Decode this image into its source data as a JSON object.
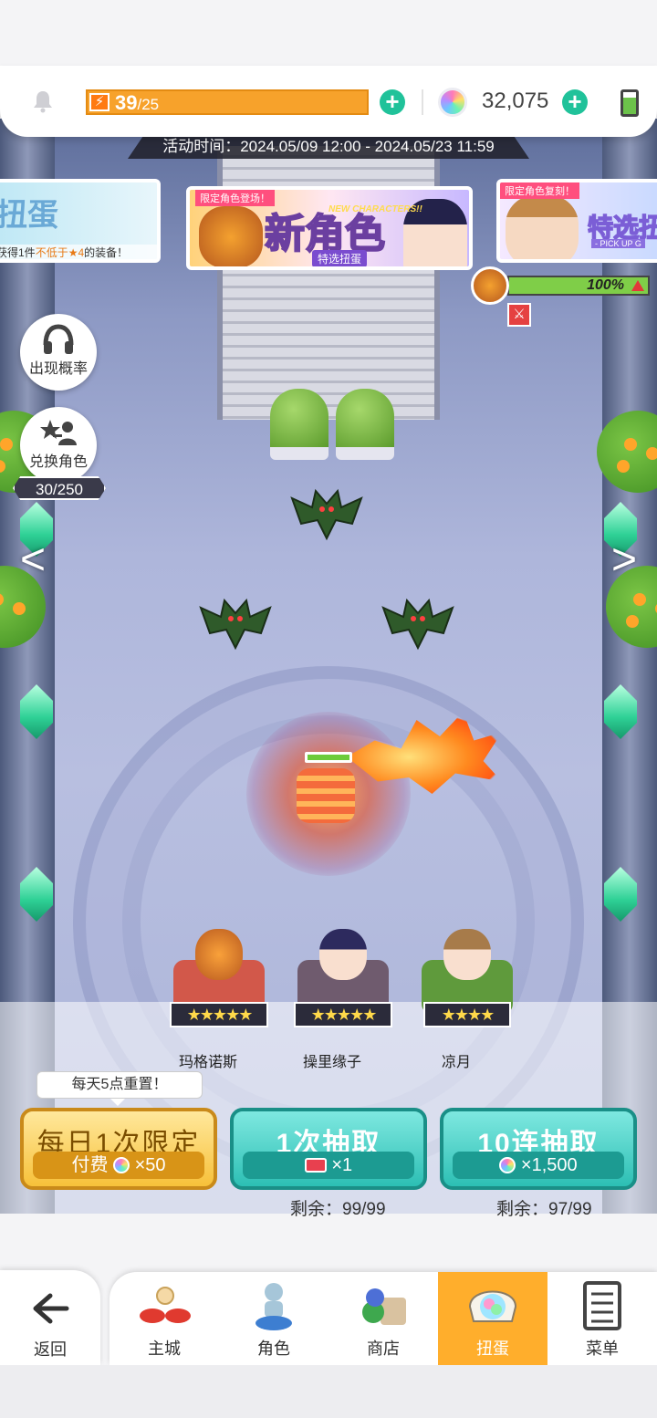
{
  "status": {
    "energy_current": "39",
    "energy_separator": "/",
    "energy_max": "25",
    "gems": "32,075"
  },
  "event": {
    "time": "活动时间：2024.05/09 12:00 - 2024.05/23 11:59"
  },
  "banners": {
    "left": {
      "title": "扭蛋",
      "desc_prefix": "获得1件",
      "desc_highlight": "不低于★4",
      "desc_suffix": "的装备！"
    },
    "center": {
      "tag": "限定角色登场！",
      "title": "新角色",
      "subtitle_en": "NEW CHARACTERS!!",
      "subtitle": "特选扭蛋"
    },
    "right": {
      "tag": "限定角色复刻！",
      "title": "特选扭",
      "subtitle": "- PICK UP G"
    }
  },
  "boss": {
    "hp_label": "100%",
    "hp_fraction": 1.0
  },
  "side_buttons": {
    "probability": "出现概率",
    "exchange": "兑换角色",
    "exchange_count": "30/250"
  },
  "nav_arrows": {
    "left": "<",
    "right": ">"
  },
  "featured": [
    {
      "name": "玛格诺斯",
      "stars": "★★★★★",
      "rarity": 5,
      "color": "#d2584a"
    },
    {
      "name": "操里缘子",
      "stars": "★★★★★",
      "rarity": 5,
      "color": "#6f5b6e"
    },
    {
      "name": "凉月",
      "stars": "★★★★",
      "rarity": 4,
      "color": "#5f9a3c"
    }
  ],
  "actions": {
    "tooltip": "每天5点重置！",
    "daily": {
      "title": "每日1次限定",
      "cost_label": "付费",
      "cost": "×50"
    },
    "single": {
      "title": "1次抽取",
      "cost": "×1",
      "remain": "剩余：99/99"
    },
    "ten": {
      "title": "10连抽取",
      "cost": "×1,500",
      "remain": "剩余：97/99"
    }
  },
  "nav": {
    "back": "返回",
    "items": [
      {
        "label": "主城",
        "icon": "castle-icon"
      },
      {
        "label": "角色",
        "icon": "character-icon"
      },
      {
        "label": "商店",
        "icon": "shop-icon"
      },
      {
        "label": "扭蛋",
        "icon": "gacha-icon",
        "active": true
      },
      {
        "label": "菜单",
        "icon": "menu-icon"
      }
    ]
  },
  "colors": {
    "accent_orange": "#ffae2c",
    "teal": "#2dbfb4",
    "gold": "#f7c13a"
  }
}
